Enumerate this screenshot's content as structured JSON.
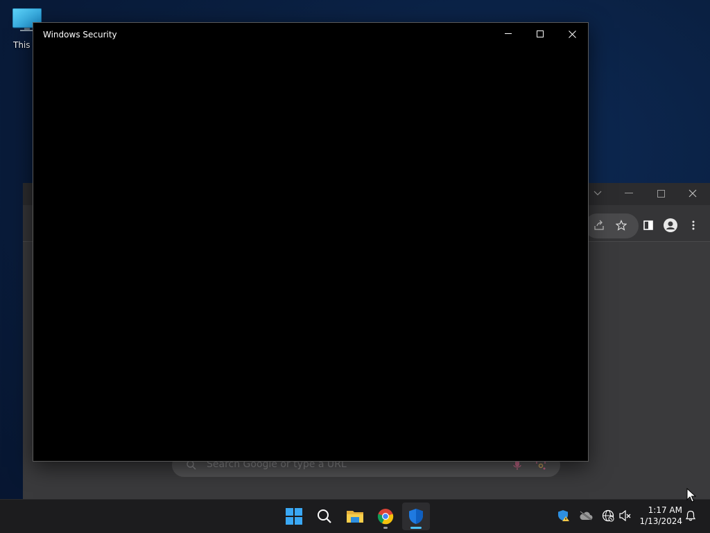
{
  "desktop": {
    "icons": [
      {
        "label": "This PC",
        "icon": "monitor-icon"
      }
    ]
  },
  "security_window": {
    "title": "Windows Security",
    "controls": [
      "minimize-icon",
      "maximize-icon",
      "close-icon"
    ]
  },
  "browser": {
    "search_placeholder": "Search Google or type a URL",
    "toolbar_icons": [
      "share-icon",
      "star-icon",
      "side-panel-icon",
      "profile-icon",
      "more-vert-icon"
    ],
    "title_controls": [
      "tab-search-icon",
      "minimize-icon",
      "maximize-icon",
      "close-icon"
    ]
  },
  "taskbar": {
    "apps": [
      {
        "name": "Start",
        "icon": "windows-logo-icon"
      },
      {
        "name": "Search",
        "icon": "search-icon"
      },
      {
        "name": "File Explorer",
        "icon": "folder-icon"
      },
      {
        "name": "Google Chrome",
        "icon": "chrome-icon",
        "running": true
      },
      {
        "name": "Windows Security",
        "icon": "shield-icon",
        "active": true
      }
    ],
    "tray_icons": [
      "security-warning-icon",
      "cloud-offline-icon",
      "network-globe-icon",
      "speaker-muted-icon",
      "notification-bell-icon"
    ],
    "clock": {
      "time": "1:17 AM",
      "date": "1/13/2024"
    }
  },
  "colors": {
    "desktop_bg": "#0a1f40",
    "window_bg": "#000000",
    "taskbar_bg": "#1c1c1e",
    "accent": "#4cc2ff"
  }
}
